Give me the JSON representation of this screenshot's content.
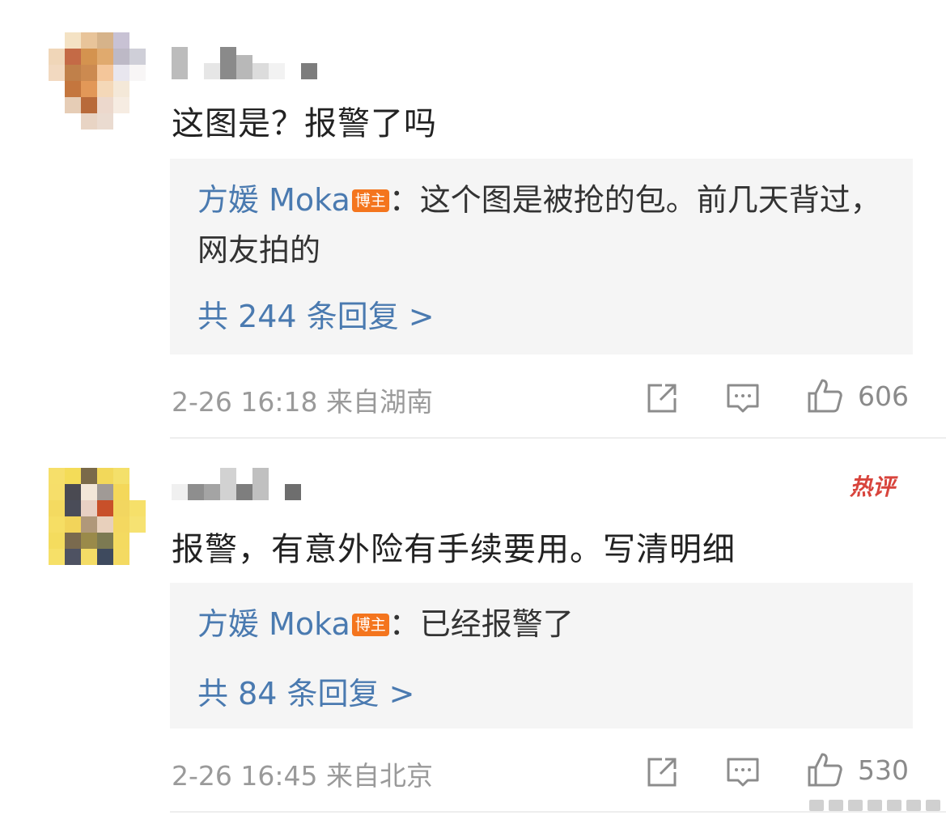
{
  "comments": [
    {
      "text": "这图是？报警了吗",
      "reply": {
        "author": "方媛 Moka",
        "badge": "博主",
        "separator": "：",
        "text": "这个图是被抢的包。前几天背过，网友拍的"
      },
      "reply_count_label": "共 244 条回复 >",
      "timestamp": "2-26 16:18",
      "location": "来自湖南",
      "like_count": "606"
    },
    {
      "text": "报警，有意外险有手续要用。写清明细",
      "hot_label": "热评",
      "reply": {
        "author": "方媛 Moka",
        "badge": "博主",
        "separator": "：",
        "text": "已经报警了"
      },
      "reply_count_label": "共 84 条回复 >",
      "timestamp": "2-26 16:45",
      "location": "来自北京",
      "like_count": "530"
    }
  ],
  "icons": {
    "share": "share-icon",
    "comment": "comment-icon",
    "like": "thumbs-up-icon"
  },
  "colors": {
    "link_blue": "#4a7ab0",
    "badge_orange": "#f4751e",
    "hot_red": "#d8443c",
    "reply_bg": "#f5f5f5"
  }
}
